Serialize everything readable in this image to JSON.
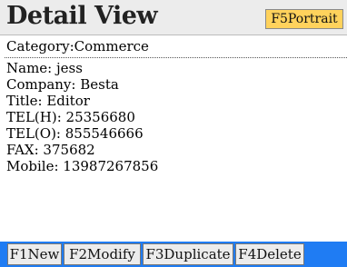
{
  "header": {
    "title": "Detail View",
    "portrait_label": "F5Portrait"
  },
  "category": "Category:Commerce",
  "details": [
    "Name: jess",
    "Company: Besta",
    "Title: Editor",
    "TEL(H): 25356680",
    "TEL(O): 855546666",
    "FAX: 375682",
    "Mobile: 13987267856"
  ],
  "toolbar": {
    "new_label": "F1New",
    "modify_label": "F2Modify",
    "duplicate_label": "F3Duplicate",
    "delete_label": "F4Delete"
  },
  "colors": {
    "header_background": "#ececec",
    "portrait_button": "#ffd25c",
    "toolbar_accent": "#1f7cf3"
  }
}
